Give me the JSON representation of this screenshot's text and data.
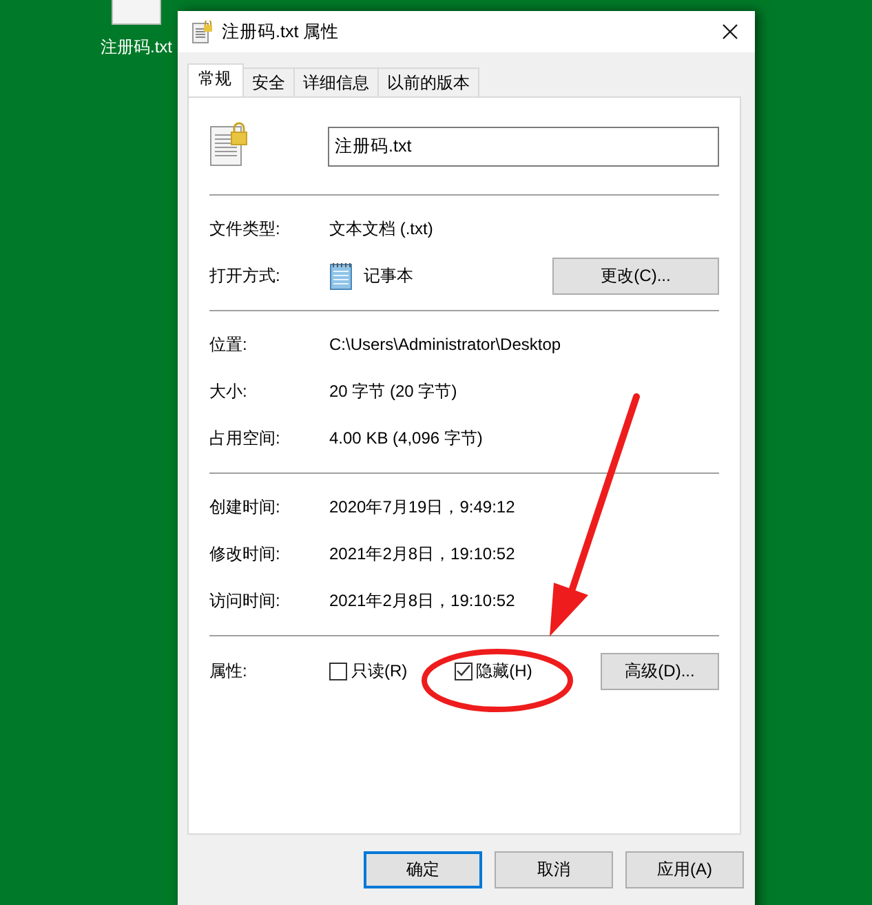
{
  "desktop_icon": {
    "label": "注册码.txt"
  },
  "window": {
    "title": "注册码.txt 属性"
  },
  "tabs": [
    {
      "label": "常规",
      "selected": true
    },
    {
      "label": "安全",
      "selected": false
    },
    {
      "label": "详细信息",
      "selected": false
    },
    {
      "label": "以前的版本",
      "selected": false
    }
  ],
  "file_name": {
    "value": "注册码.txt"
  },
  "sections": [
    [
      {
        "kind": "text",
        "label": "文件类型:",
        "value": "文本文档 (.txt)"
      },
      {
        "kind": "app",
        "label": "打开方式:",
        "value": "记事本",
        "button": "更改(C)..."
      }
    ],
    [
      {
        "kind": "text",
        "label": "位置:",
        "value": "C:\\Users\\Administrator\\Desktop"
      },
      {
        "kind": "text",
        "label": "大小:",
        "value": "20 字节 (20 字节)"
      },
      {
        "kind": "text",
        "label": "占用空间:",
        "value": "4.00 KB (4,096 字节)"
      }
    ],
    [
      {
        "kind": "text",
        "label": "创建时间:",
        "value": "2020年7月19日，9:49:12"
      },
      {
        "kind": "text",
        "label": "修改时间:",
        "value": "2021年2月8日，19:10:52"
      },
      {
        "kind": "text",
        "label": "访问时间:",
        "value": "2021年2月8日，19:10:52"
      }
    ]
  ],
  "attributes": {
    "label": "属性:",
    "checkboxes": [
      {
        "label": "只读(R)",
        "checked": false
      },
      {
        "label": "隐藏(H)",
        "checked": true
      }
    ],
    "button": "高级(D)..."
  },
  "buttons": [
    {
      "label": "确定",
      "default": true
    },
    {
      "label": "取消",
      "default": false
    },
    {
      "label": "应用(A)",
      "default": false
    }
  ]
}
